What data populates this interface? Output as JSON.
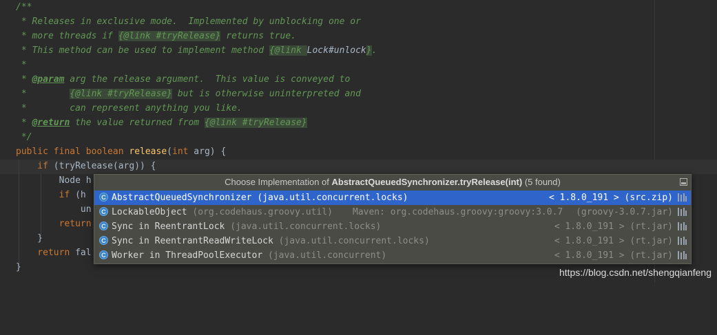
{
  "code": {
    "l1": "/**",
    "l2": " * Releases in exclusive mode.  Implemented by unblocking one or",
    "l3a": " * more threads if ",
    "l3b": "{@link ",
    "l3c": "#tryRelease",
    "l3d": "}",
    "l3e": " returns true.",
    "l4a": " * This method can be used to implement method ",
    "l4b": "{@link ",
    "l4c": "Lock#unlock",
    "l4d": "}",
    "l4e": ".",
    "l5": " *",
    "l6a": " * ",
    "l6b": "@param",
    "l6c": " arg the release argument.  This value is conveyed to",
    "l7a": " *        ",
    "l7b": "{@link ",
    "l7c": "#tryRelease",
    "l7d": "}",
    "l7e": " but is otherwise uninterpreted and",
    "l8": " *        can represent anything you like.",
    "l9a": " * ",
    "l9b": "@return",
    "l9c": " the value returned from ",
    "l9d": "{@link ",
    "l9e": "#tryRelease",
    "l9f": "}",
    "l10": " */",
    "l11kw": "public final boolean ",
    "l11fn": "release",
    "l11rest": "(",
    "l11int": "int",
    "l11end": " arg) {",
    "l12kw": "    if ",
    "l12rest": "(tryRelease(arg)) {",
    "l13": "        Node h",
    "l14kw": "        if ",
    "l14rest": "(h",
    "l15": "            un",
    "l16kw": "        return",
    "l17": "    }",
    "l18kw": "    return ",
    "l18rest": "fal",
    "l19": "}"
  },
  "popup": {
    "title_prefix": "Choose Implementation of ",
    "title_bold": "AbstractQueuedSynchronizer.tryRelease(int)",
    "title_suffix": " (5 found)",
    "items": [
      {
        "icon": "C",
        "name": "AbstractQueuedSynchronizer",
        "pkg": " (java.util.concurrent.locks)",
        "maven": "",
        "version": "< 1.8.0_191 > (src.zip)"
      },
      {
        "icon": "C",
        "name": "LockableObject",
        "pkg": " (org.codehaus.groovy.util)",
        "maven": "Maven: org.codehaus.groovy:groovy:3.0.7",
        "version": "(groovy-3.0.7.jar)"
      },
      {
        "icon": "C",
        "name": "Sync in ReentrantLock",
        "pkg": " (java.util.concurrent.locks)",
        "maven": "",
        "version": "< 1.8.0_191 > (rt.jar)"
      },
      {
        "icon": "C",
        "name": "Sync in ReentrantReadWriteLock",
        "pkg": " (java.util.concurrent.locks)",
        "maven": "",
        "version": "< 1.8.0_191 > (rt.jar)"
      },
      {
        "icon": "C",
        "name": "Worker in ThreadPoolExecutor",
        "pkg": " (java.util.concurrent)",
        "maven": "",
        "version": "< 1.8.0_191 > (rt.jar)"
      }
    ]
  },
  "watermark": "https://blog.csdn.net/shengqianfeng",
  "colors": {
    "background": "#2b2b2b",
    "doc_comment": "#629755",
    "keyword": "#cc7832",
    "method": "#ffc66d",
    "selection": "#2f65ca",
    "popup_bg": "#4b4b45"
  }
}
